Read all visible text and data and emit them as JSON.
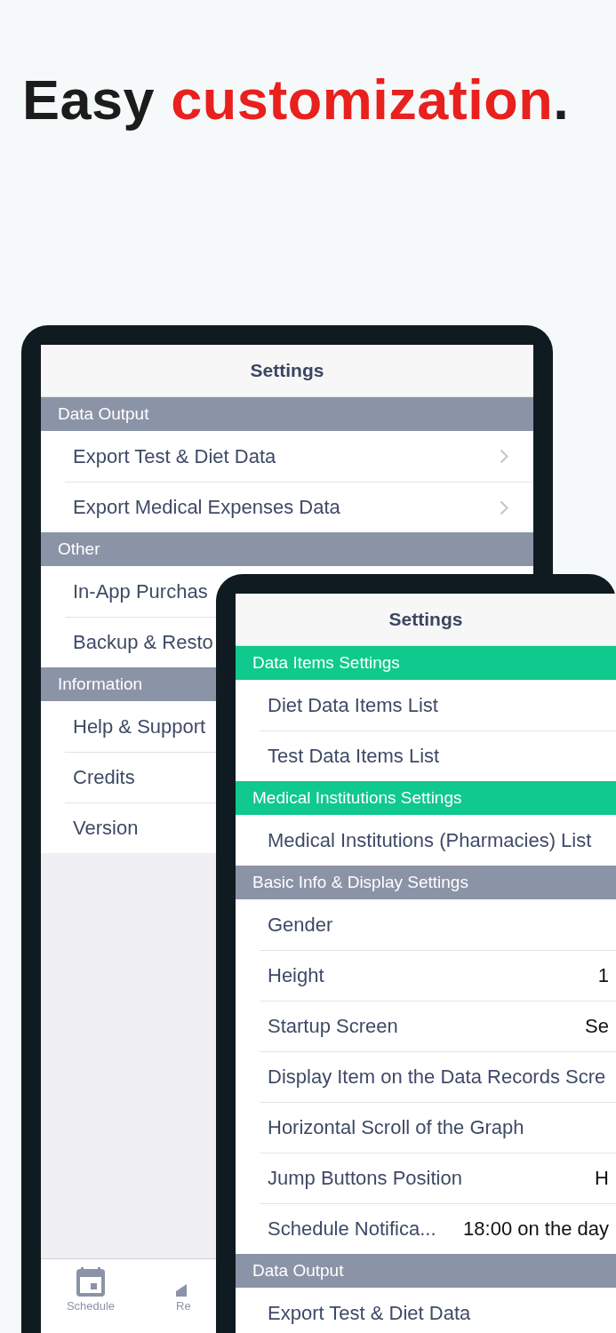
{
  "headline": {
    "parts": [
      {
        "text": "Easy ",
        "accent": false
      },
      {
        "text": "customization",
        "accent": true
      },
      {
        "text": ".",
        "accent": false
      }
    ]
  },
  "back_screen": {
    "title": "Settings",
    "sections": [
      {
        "title": "Data Output",
        "color": "#8b93a7",
        "rows": [
          {
            "label": "Export Test & Diet Data",
            "chevron": true
          },
          {
            "label": "Export Medical Expenses Data",
            "chevron": true
          }
        ]
      },
      {
        "title": "Other",
        "color": "#8b93a7",
        "rows": [
          {
            "label": "In-App Purchas"
          },
          {
            "label": "Backup & Resto"
          }
        ]
      },
      {
        "title": "Information",
        "color": "#8b93a7",
        "rows": [
          {
            "label": "Help & Support"
          },
          {
            "label": "Credits"
          },
          {
            "label": "Version"
          }
        ]
      }
    ],
    "tabs": [
      {
        "label": "Schedule",
        "selected": false
      },
      {
        "label": "Re",
        "selected": false
      }
    ]
  },
  "front_screen": {
    "title": "Settings",
    "sections": [
      {
        "title": "Data Items Settings",
        "color": "#10c98c",
        "rows": [
          {
            "label": "Diet Data Items List"
          },
          {
            "label": "Test Data Items List"
          }
        ]
      },
      {
        "title": "Medical Institutions Settings",
        "color": "#10c98c",
        "rows": [
          {
            "label": "Medical Institutions (Pharmacies) List"
          }
        ]
      },
      {
        "title": "Basic Info & Display Settings",
        "color": "#8b93a7",
        "rows": [
          {
            "label": "Gender"
          },
          {
            "label": "Height",
            "value": "1"
          },
          {
            "label": "Startup Screen",
            "value": "Se"
          },
          {
            "label": "Display Item on the Data Records Scre"
          },
          {
            "label": "Horizontal Scroll of the Graph"
          },
          {
            "label": "Jump Buttons Position",
            "value": "H"
          },
          {
            "label": "Schedule Notifica...",
            "value": "18:00 on the day"
          }
        ]
      },
      {
        "title": "Data Output",
        "color": "#8b93a7",
        "rows": [
          {
            "label": "Export Test & Diet Data"
          }
        ]
      }
    ]
  }
}
